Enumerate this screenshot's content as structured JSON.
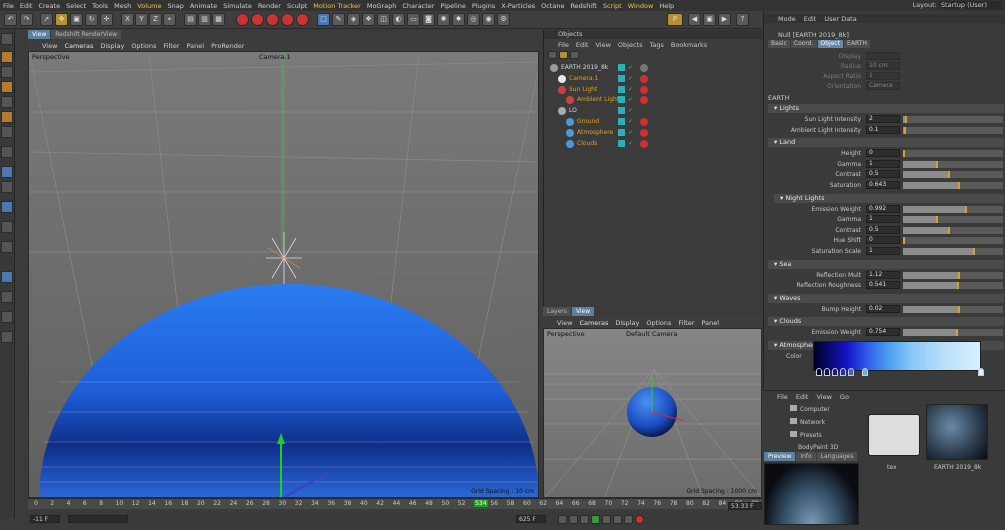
{
  "menubar": [
    "File",
    "Edit",
    "Create",
    "Select",
    "Tools",
    "Mesh",
    "Volume",
    "Snap",
    "Animate",
    "Simulate",
    "Render",
    "Sculpt",
    "Motion Tracker",
    "MoGraph",
    "Character",
    "Pipeline",
    "Plugins",
    "X-Particles",
    "Octane",
    "Redshift",
    "Script",
    "Window",
    "Help"
  ],
  "layout": {
    "label": "Layout:",
    "value": "Startup (User)"
  },
  "view_tabs": [
    "View",
    "Redshift RenderView"
  ],
  "viewport_menu": [
    "View",
    "Cameras",
    "Display",
    "Options",
    "Filter",
    "Panel",
    "ProRender"
  ],
  "viewport": {
    "name": "Perspective",
    "camera": "Camera.1",
    "grid": "Grid Spacing : 10 cm"
  },
  "timeline": {
    "ticks": [
      "0",
      "2",
      "4",
      "6",
      "8",
      "10",
      "12",
      "14",
      "16",
      "18",
      "20",
      "22",
      "24",
      "26",
      "28",
      "30",
      "32",
      "34",
      "36",
      "38",
      "40",
      "42",
      "44",
      "46",
      "48",
      "50",
      "52",
      "534",
      "56",
      "58",
      "60",
      "62",
      "64",
      "66",
      "68",
      "70",
      "72",
      "74",
      "76",
      "78",
      "80",
      "82",
      "84",
      "86",
      "88"
    ],
    "start": "-11 F",
    "current": "625 F",
    "end": "53.33 F"
  },
  "objects": {
    "title": "Objects",
    "menu": [
      "File",
      "Edit",
      "View",
      "Objects",
      "Tags",
      "Bookmarks"
    ],
    "rows": [
      {
        "name": "EARTH 2019_8k",
        "level": 0
      },
      {
        "name": "Camera.1",
        "level": 1
      },
      {
        "name": "Sun Light",
        "level": 1
      },
      {
        "name": "Ambient Light",
        "level": 2
      },
      {
        "name": "LO",
        "level": 1
      },
      {
        "name": "Ground",
        "level": 2
      },
      {
        "name": "Atmosphere",
        "level": 2
      },
      {
        "name": "Clouds",
        "level": 2
      }
    ]
  },
  "bottom_tabs": [
    "Layers",
    "View"
  ],
  "viewport2_menu": [
    "View",
    "Cameras",
    "Display",
    "Options",
    "Filter",
    "Panel"
  ],
  "viewport2": {
    "name": "Perspective",
    "camera": "Default Camera",
    "grid": "Grid Spacing : 1000 cm"
  },
  "attributes": {
    "menu": [
      "Mode",
      "Edit",
      "User Data"
    ],
    "title": "Null [EARTH 2019_8k]",
    "tabs": [
      "Basic",
      "Coord.",
      "Object",
      "EARTH"
    ],
    "faded": [
      {
        "label": "Display",
        "value": ""
      },
      {
        "label": "Radius",
        "value": "10 cm"
      },
      {
        "label": "Aspect Ratio",
        "value": "1"
      },
      {
        "label": "Orientation",
        "value": "Camera"
      }
    ],
    "earth_header": "EARTH",
    "lights": {
      "label": "Lights",
      "params": [
        {
          "label": "Sun Light Intensity",
          "value": "2",
          "fill": 0.02
        },
        {
          "label": "Ambient Light Intensity",
          "value": "0.1",
          "fill": 0.01
        }
      ]
    },
    "land": {
      "label": "Land",
      "params": [
        {
          "label": "Height",
          "value": "0",
          "fill": 0.0
        },
        {
          "label": "Gamma",
          "value": "1",
          "fill": 0.33
        },
        {
          "label": "Contrast",
          "value": "0.5",
          "fill": 0.45
        },
        {
          "label": "Saturation",
          "value": "0.643",
          "fill": 0.55
        }
      ]
    },
    "night": {
      "label": "Night Lights",
      "params": [
        {
          "label": "Emission Weight",
          "value": "0.992",
          "fill": 0.62
        },
        {
          "label": "Gamma",
          "value": "1",
          "fill": 0.33
        },
        {
          "label": "Contrast",
          "value": "0.5",
          "fill": 0.45
        },
        {
          "label": "Hue Shift",
          "value": "0",
          "fill": 0.0
        },
        {
          "label": "Saturation Scale",
          "value": "1",
          "fill": 0.7
        }
      ]
    },
    "sea": {
      "label": "Sea",
      "params": [
        {
          "label": "Reflection Mult",
          "value": "1.12",
          "fill": 0.55
        },
        {
          "label": "Reflection Roughness",
          "value": "0.541",
          "fill": 0.54
        }
      ]
    },
    "waves": {
      "label": "Waves",
      "params": [
        {
          "label": "Bump Height",
          "value": "0.02",
          "fill": 0.55
        }
      ]
    },
    "clouds": {
      "label": "Clouds",
      "params": [
        {
          "label": "Emission Weight",
          "value": "0.754",
          "fill": 0.53
        }
      ]
    },
    "atmosphere": {
      "label": "Atmosphere",
      "color_label": "Color"
    }
  },
  "browser": {
    "menu": [
      "File",
      "Edit",
      "View",
      "Go"
    ],
    "tree": [
      "Computer",
      "Network",
      "Presets",
      "BodyPaint 3D"
    ],
    "items": [
      {
        "name": "tex"
      },
      {
        "name": "EARTH 2019_8k"
      }
    ],
    "tabs": [
      "Preview",
      "Info",
      "Languages"
    ]
  }
}
